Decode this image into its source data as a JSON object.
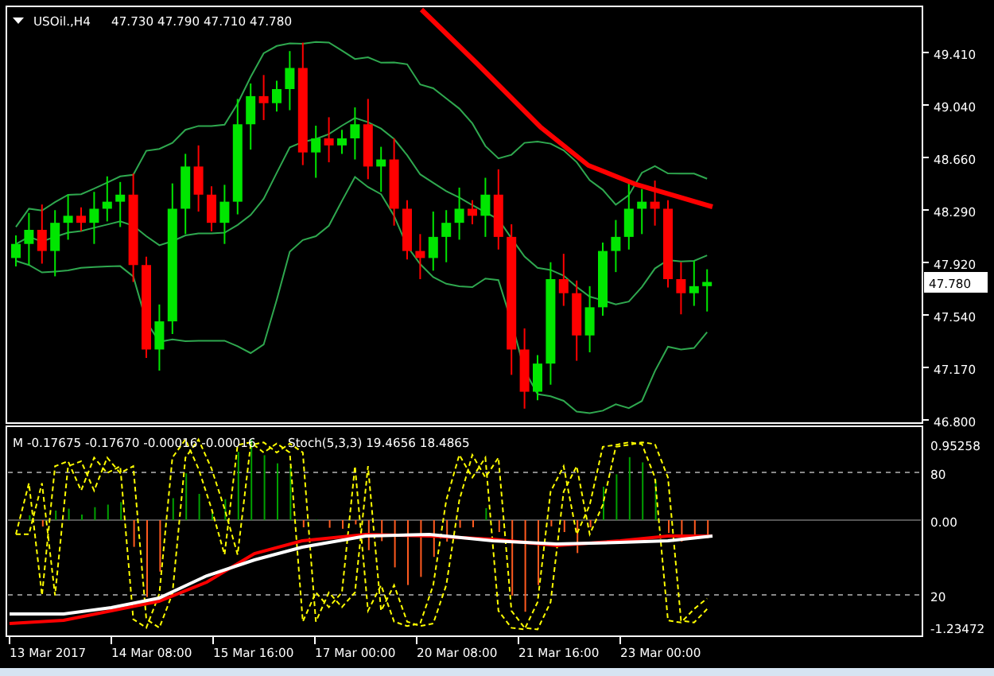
{
  "main_chart": {
    "symbol": "USOil.,H4",
    "ohlc": "47.730 47.790 47.710 47.780",
    "price_axis": [
      "49.410",
      "49.040",
      "48.660",
      "48.290",
      "47.920",
      "47.540",
      "47.170",
      "46.800"
    ],
    "current_price": "47.780"
  },
  "indicator_window": {
    "macd_label": "M -0.17675 -0.17670 -0.00016 -0.00016",
    "stoch_label": "Stoch(5,3,3) 19.4656 18.4865",
    "axis": [
      "0.95258",
      "80",
      "0.00",
      "20",
      "-1.23472"
    ]
  },
  "time_axis": [
    "13 Mar 2017",
    "14 Mar 08:00",
    "15 Mar 16:00",
    "17 Mar 00:00",
    "20 Mar 08:00",
    "21 Mar 16:00",
    "23 Mar 00:00"
  ]
}
